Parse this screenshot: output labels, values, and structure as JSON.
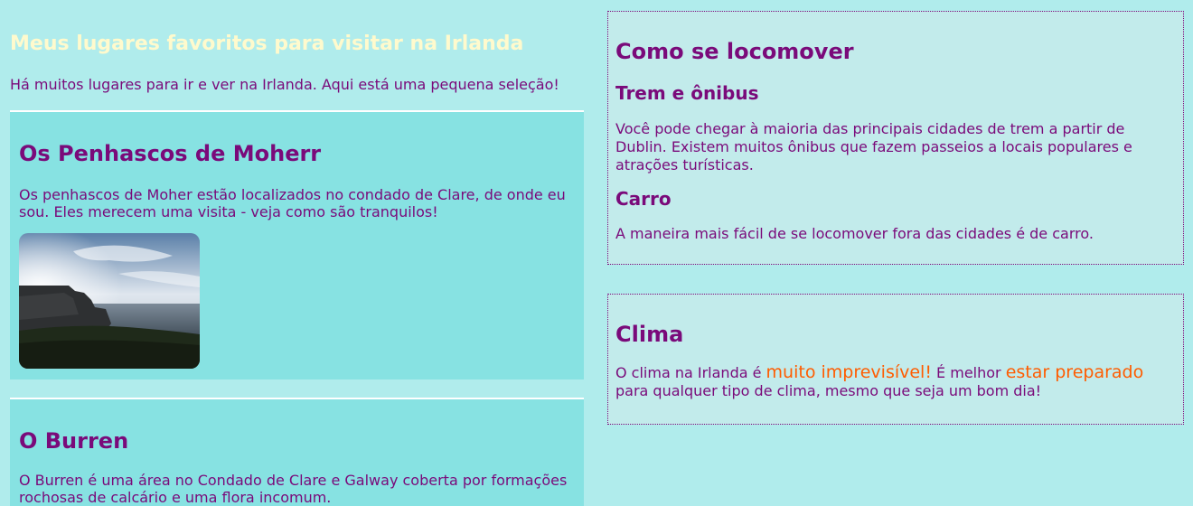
{
  "page": {
    "title": "Meus lugares favoritos para visitar na Irlanda",
    "intro": "Há muitos lugares para ir e ver na Irlanda. Aqui está uma pequena seleção!"
  },
  "places": [
    {
      "title": "Os Penhascos de Moherr",
      "text": "Os penhascos de Moher estão localizados no condado de Clare, de onde eu sou. Eles merecem uma visita - veja como são tranquilos!"
    },
    {
      "title": "O Burren",
      "text": "O Burren é uma área no Condado de Clare e Galway coberta por formações rochosas de calcário e uma flora incomum."
    }
  ],
  "transport": {
    "title": "Como se locomover",
    "train_title": "Trem e ônibus",
    "train_text": "Você pode chegar à maioria das principais cidades de trem a partir de Dublin. Existem muitos ônibus que fazem passeios a locais populares e atrações turísticas.",
    "car_title": "Carro",
    "car_text": "A maneira mais fácil de se locomover fora das cidades é de carro."
  },
  "weather": {
    "title": "Clima",
    "text_1": "O clima na Irlanda é ",
    "highlight_1": "muito imprevisível!",
    "text_2": " É melhor ",
    "highlight_2": "estar preparado",
    "text_3": " para qualquer tipo de clima, mesmo que seja um bom dia!"
  },
  "colors": {
    "background": "#b0ecec",
    "card": "#87e2e2",
    "text": "#7a0a7a",
    "title": "#fffacd",
    "highlight": "#ff5c00"
  }
}
